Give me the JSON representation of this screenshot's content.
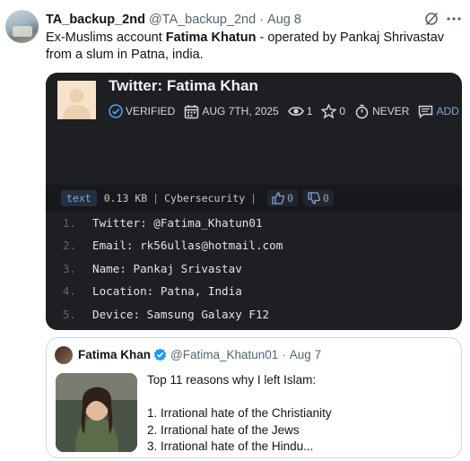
{
  "tweet": {
    "display_name": "TA_backup_2nd",
    "handle": "@TA_backup_2nd",
    "separator": "·",
    "date": "Aug 8",
    "text_prefix": "Ex-Muslims account ",
    "text_bold": "Fatima Khatun",
    "text_suffix": " - operated by Pankaj Shrivastav from a slum in Patna, india.",
    "icons": {
      "grok": "grok-icon",
      "more": "more-options-icon"
    }
  },
  "card": {
    "title": "Twitter: Fatima Khan",
    "meta": {
      "verified_label": "VERIFIED",
      "date_label": "AUG 7TH, 2025",
      "views_count": "1",
      "stars_count": "0",
      "expiry_label": "NEVER",
      "add_label": "ADD"
    },
    "file_bar": {
      "language": "text",
      "size": "0.13 KB",
      "separator": "|",
      "category": "Cybersecurity",
      "upvotes": "0",
      "downvotes": "0"
    },
    "lines": [
      {
        "number": "1.",
        "text": "Twitter: @Fatima_Khatun01"
      },
      {
        "number": "2.",
        "text": "Email: rk56ullas@hotmail.com"
      },
      {
        "number": "3.",
        "text": "Name: Pankaj Srivastav"
      },
      {
        "number": "4.",
        "text": "Location: Patna, India"
      },
      {
        "number": "5.",
        "text": "Device: Samsung Galaxy F12"
      }
    ],
    "colors": {
      "background": "#1e1f23",
      "accent": "#7fa6d6"
    }
  },
  "quote": {
    "display_name": "Fatima Khan",
    "handle": "@Fatima_Khatun01",
    "separator": "·",
    "date": "Aug 7",
    "verified_color": "#1d9bf0",
    "lines": [
      "Top 11 reasons why I left Islam:",
      "",
      "1. Irrational hate of the Christianity",
      "2. Irrational hate of the Jews",
      "3. Irrational hate of the Hindu..."
    ]
  }
}
